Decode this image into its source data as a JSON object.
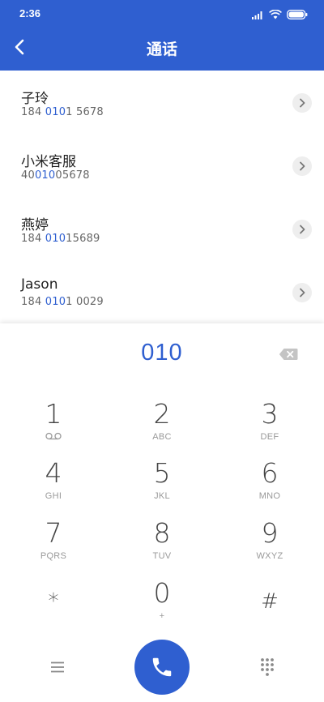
{
  "status_bar": {
    "time": "2:36"
  },
  "header": {
    "title": "通话"
  },
  "contacts": [
    {
      "name": "子玲",
      "number_pre": "184 ",
      "number_match": "010",
      "number_post": "1 5678"
    },
    {
      "name": "小米客服",
      "number_pre": "40",
      "number_match": "010",
      "number_post": "05678"
    },
    {
      "name": "燕婷",
      "number_pre": "184 ",
      "number_match": "010",
      "number_post": "15689"
    },
    {
      "name": "Jason",
      "number_pre": "184 ",
      "number_match": "010",
      "number_post": "1 0029"
    }
  ],
  "dialpad": {
    "input": "010",
    "keys": [
      {
        "digit": "1",
        "letters": ""
      },
      {
        "digit": "2",
        "letters": "ABC"
      },
      {
        "digit": "3",
        "letters": "DEF"
      },
      {
        "digit": "4",
        "letters": "GHI"
      },
      {
        "digit": "5",
        "letters": "JKL"
      },
      {
        "digit": "6",
        "letters": "MNO"
      },
      {
        "digit": "7",
        "letters": "PQRS"
      },
      {
        "digit": "8",
        "letters": "TUV"
      },
      {
        "digit": "9",
        "letters": "WXYZ"
      },
      {
        "digit": "*",
        "letters": ""
      },
      {
        "digit": "0",
        "letters": "+"
      },
      {
        "digit": "#",
        "letters": ""
      }
    ]
  },
  "colors": {
    "accent": "#2f5fd0"
  },
  "icons": {
    "back": "back-arrow-icon",
    "voicemail": "voicemail-icon",
    "backspace": "backspace-icon",
    "menu": "menu-icon",
    "call": "phone-icon",
    "keypad": "dialpad-icon"
  }
}
